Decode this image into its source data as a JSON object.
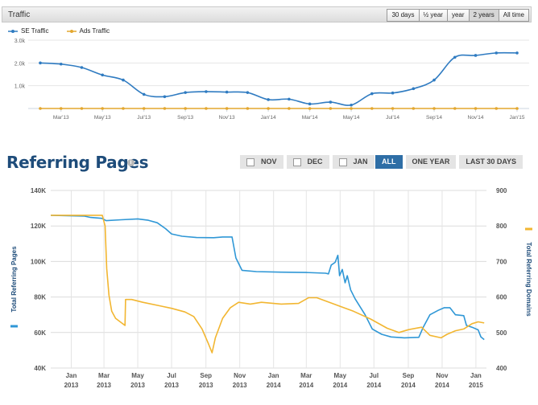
{
  "traffic": {
    "title": "Traffic",
    "ranges": [
      "30 days",
      "½ year",
      "year",
      "2 years",
      "All time"
    ],
    "active_range": "2 years",
    "legend": [
      {
        "name": "SE Traffic",
        "color": "#2f7bc1"
      },
      {
        "name": "Ads Traffic",
        "color": "#e3a72f"
      }
    ]
  },
  "referring": {
    "title": "Referring Pages",
    "info_glyph": "i",
    "filters": [
      {
        "label": "NOV",
        "checkbox": true,
        "active": false
      },
      {
        "label": "DEC",
        "checkbox": true,
        "active": false
      },
      {
        "label": "JAN",
        "checkbox": true,
        "active": false
      },
      {
        "label": "ALL",
        "checkbox": false,
        "active": true
      },
      {
        "label": "ONE YEAR",
        "checkbox": false,
        "active": false
      },
      {
        "label": "LAST 30 DAYS",
        "checkbox": false,
        "active": false
      }
    ]
  },
  "chart_data": [
    {
      "type": "line",
      "title": "",
      "xlabel": "",
      "ylabel": "",
      "ylim": [
        0,
        3000
      ],
      "yticks": [
        "1.0k",
        "2.0k",
        "3.0k"
      ],
      "ytick_values": [
        1000,
        2000,
        3000
      ],
      "xtick_labels": [
        "Mar'13",
        "May'13",
        "Jul'13",
        "Sep'13",
        "Nov'13",
        "Jan'14",
        "Mar'14",
        "May'14",
        "Jul'14",
        "Sep'14",
        "Nov'14",
        "Jan'15"
      ],
      "x": [
        0,
        1,
        2,
        3,
        4,
        5,
        6,
        7,
        8,
        9,
        10,
        11,
        12,
        13,
        14,
        15,
        16,
        17,
        18,
        19,
        20,
        21,
        22,
        23
      ],
      "x_dates": [
        "Feb'13",
        "Mar'13",
        "Apr'13",
        "May'13",
        "Jun'13",
        "Jul'13",
        "Aug'13",
        "Sep'13",
        "Oct'13",
        "Nov'13",
        "Dec'13",
        "Jan'14",
        "Feb'14",
        "Mar'14",
        "Apr'14",
        "May'14",
        "Jun'14",
        "Jul'14",
        "Aug'14",
        "Sep'14",
        "Oct'14",
        "Nov'14",
        "Dec'14",
        "Jan'15"
      ],
      "series": [
        {
          "name": "SE Traffic",
          "color": "#2f7bc1",
          "values": [
            2000,
            1950,
            1800,
            1470,
            1250,
            620,
            520,
            700,
            740,
            720,
            700,
            390,
            410,
            200,
            280,
            150,
            650,
            680,
            870,
            1250,
            2250,
            2330,
            2440,
            2440
          ]
        },
        {
          "name": "Ads Traffic",
          "color": "#e3a72f",
          "values": [
            0,
            0,
            0,
            0,
            0,
            0,
            0,
            0,
            0,
            0,
            0,
            0,
            0,
            0,
            0,
            0,
            0,
            0,
            0,
            0,
            0,
            0,
            0,
            0
          ]
        }
      ]
    },
    {
      "type": "line",
      "title": "",
      "xlabel": "",
      "ylabel": "Total Referring Pages",
      "y2label": "Total Referring Domains",
      "ylim": [
        40000,
        140000
      ],
      "y2lim": [
        400,
        900
      ],
      "yticks": [
        "40K",
        "60K",
        "80K",
        "100K",
        "120K",
        "140K"
      ],
      "ytick_values": [
        40000,
        60000,
        80000,
        100000,
        120000,
        140000
      ],
      "y2ticks": [
        "400",
        "500",
        "600",
        "700",
        "800",
        "900"
      ],
      "y2tick_values": [
        400,
        500,
        600,
        700,
        800,
        900
      ],
      "x_domain": [
        "2012-11-25",
        "2015-01-20"
      ],
      "xticks": [
        {
          "date": "2013-01-01",
          "month": "Jan",
          "year": "2013"
        },
        {
          "date": "2013-03-01",
          "month": "Mar",
          "year": "2013"
        },
        {
          "date": "2013-05-01",
          "month": "May",
          "year": "2013"
        },
        {
          "date": "2013-07-01",
          "month": "Jul",
          "year": "2013"
        },
        {
          "date": "2013-09-01",
          "month": "Sep",
          "year": "2013"
        },
        {
          "date": "2013-11-01",
          "month": "Nov",
          "year": "2013"
        },
        {
          "date": "2014-01-01",
          "month": "Jan",
          "year": "2014"
        },
        {
          "date": "2014-03-01",
          "month": "Mar",
          "year": "2014"
        },
        {
          "date": "2014-05-01",
          "month": "May",
          "year": "2014"
        },
        {
          "date": "2014-07-01",
          "month": "Jul",
          "year": "2014"
        },
        {
          "date": "2014-09-01",
          "month": "Sep",
          "year": "2014"
        },
        {
          "date": "2014-11-01",
          "month": "Nov",
          "year": "2014"
        },
        {
          "date": "2015-01-01",
          "month": "Jan",
          "year": "2015"
        }
      ],
      "series": [
        {
          "name": "Total Referring Pages",
          "axis": "left",
          "color": "#2f97d6",
          "points": [
            [
              "2012-11-25",
              126000
            ],
            [
              "2013-01-25",
              125500
            ],
            [
              "2013-02-05",
              124800
            ],
            [
              "2013-02-25",
              124300
            ],
            [
              "2013-03-05",
              123000
            ],
            [
              "2013-04-01",
              123500
            ],
            [
              "2013-05-01",
              124000
            ],
            [
              "2013-05-20",
              123200
            ],
            [
              "2013-06-05",
              121800
            ],
            [
              "2013-06-20",
              118500
            ],
            [
              "2013-07-01",
              115500
            ],
            [
              "2013-07-20",
              114200
            ],
            [
              "2013-08-15",
              113500
            ],
            [
              "2013-09-15",
              113400
            ],
            [
              "2013-10-01",
              113800
            ],
            [
              "2013-10-18",
              113800
            ],
            [
              "2013-10-25",
              102000
            ],
            [
              "2013-11-05",
              95000
            ],
            [
              "2013-12-01",
              94300
            ],
            [
              "2014-01-15",
              94000
            ],
            [
              "2014-03-01",
              93800
            ],
            [
              "2014-04-05",
              93400
            ],
            [
              "2014-04-10",
              93000
            ],
            [
              "2014-04-15",
              98000
            ],
            [
              "2014-04-22",
              99500
            ],
            [
              "2014-04-27",
              103500
            ],
            [
              "2014-04-30",
              92000
            ],
            [
              "2014-05-05",
              95500
            ],
            [
              "2014-05-10",
              88000
            ],
            [
              "2014-05-14",
              92000
            ],
            [
              "2014-05-20",
              84000
            ],
            [
              "2014-05-28",
              79000
            ],
            [
              "2014-06-15",
              70000
            ],
            [
              "2014-06-28",
              62000
            ],
            [
              "2014-07-15",
              59000
            ],
            [
              "2014-08-01",
              57500
            ],
            [
              "2014-08-25",
              57000
            ],
            [
              "2014-09-20",
              57300
            ],
            [
              "2014-09-28",
              63000
            ],
            [
              "2014-10-10",
              70000
            ],
            [
              "2014-10-25",
              72500
            ],
            [
              "2014-11-05",
              74000
            ],
            [
              "2014-11-15",
              74000
            ],
            [
              "2014-11-25",
              70000
            ],
            [
              "2014-12-10",
              69500
            ],
            [
              "2014-12-15",
              64000
            ],
            [
              "2014-12-25",
              63000
            ],
            [
              "2015-01-05",
              61500
            ],
            [
              "2015-01-10",
              57500
            ],
            [
              "2015-01-16",
              56000
            ]
          ]
        },
        {
          "name": "Total Referring Domains",
          "axis": "right",
          "color": "#f2b631",
          "points": [
            [
              "2012-11-25",
              830
            ],
            [
              "2013-02-26",
              830
            ],
            [
              "2013-03-03",
              800
            ],
            [
              "2013-03-06",
              680
            ],
            [
              "2013-03-10",
              605
            ],
            [
              "2013-03-15",
              560
            ],
            [
              "2013-03-22",
              540
            ],
            [
              "2013-04-01",
              528
            ],
            [
              "2013-04-08",
              520
            ],
            [
              "2013-04-09",
              593
            ],
            [
              "2013-04-20",
              593
            ],
            [
              "2013-05-10",
              585
            ],
            [
              "2013-06-10",
              575
            ],
            [
              "2013-07-01",
              568
            ],
            [
              "2013-07-25",
              558
            ],
            [
              "2013-08-10",
              545
            ],
            [
              "2013-08-25",
              510
            ],
            [
              "2013-09-05",
              470
            ],
            [
              "2013-09-12",
              443
            ],
            [
              "2013-09-18",
              485
            ],
            [
              "2013-10-01",
              540
            ],
            [
              "2013-10-15",
              570
            ],
            [
              "2013-10-30",
              585
            ],
            [
              "2013-11-20",
              580
            ],
            [
              "2013-12-10",
              585
            ],
            [
              "2014-01-15",
              580
            ],
            [
              "2014-02-15",
              582
            ],
            [
              "2014-03-05",
              598
            ],
            [
              "2014-03-20",
              598
            ],
            [
              "2014-04-20",
              580
            ],
            [
              "2014-05-25",
              560
            ],
            [
              "2014-06-25",
              538
            ],
            [
              "2014-07-25",
              512
            ],
            [
              "2014-08-15",
              500
            ],
            [
              "2014-09-01",
              508
            ],
            [
              "2014-09-25",
              515
            ],
            [
              "2014-10-10",
              492
            ],
            [
              "2014-10-30",
              485
            ],
            [
              "2014-11-10",
              495
            ],
            [
              "2014-11-25",
              505
            ],
            [
              "2014-12-10",
              510
            ],
            [
              "2014-12-25",
              525
            ],
            [
              "2015-01-05",
              530
            ],
            [
              "2015-01-16",
              527
            ]
          ]
        }
      ]
    }
  ]
}
